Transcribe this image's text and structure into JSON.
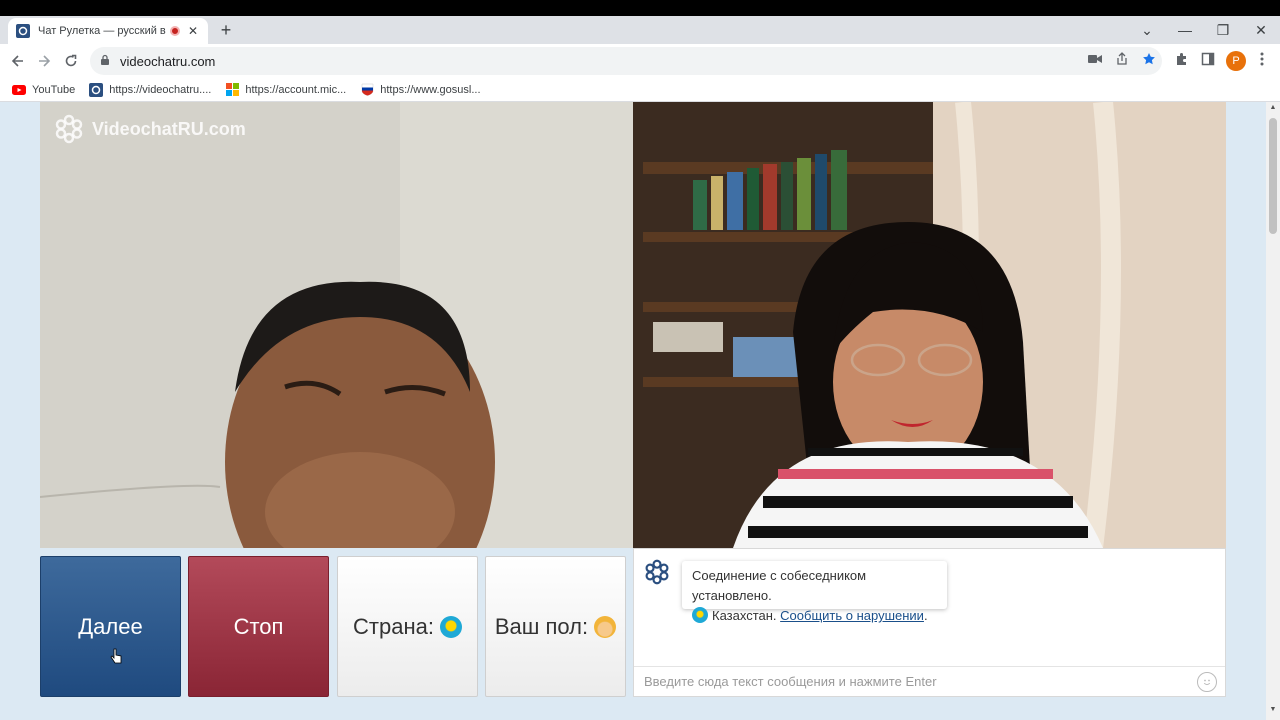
{
  "browser": {
    "tab_title": "Чат Рулетка — русский вид",
    "tab_close": "✕",
    "new_tab": "+",
    "url": "videochatru.com",
    "profile_initial": "P",
    "controls": {
      "dropdown": "⌄",
      "minimize": "—",
      "restore": "❐",
      "close": "✕"
    }
  },
  "bookmarks": [
    {
      "label": "YouTube",
      "icon": "youtube-icon"
    },
    {
      "label": "https://videochatru....",
      "icon": "videochat-icon"
    },
    {
      "label": "https://account.mic...",
      "icon": "microsoft-icon"
    },
    {
      "label": "https://www.gosusl...",
      "icon": "gosuslugi-icon"
    }
  ],
  "site": {
    "logo_text": "VideochatRU.com",
    "buttons": {
      "next": "Далее",
      "stop": "Стоп",
      "country": "Страна:",
      "gender": "Ваш пол:"
    },
    "chat": {
      "system_message": "Соединение с собеседником установлено.",
      "country": "Казахстан.",
      "report_link": "Сообщить о нарушении",
      "trailing": ".",
      "input_placeholder": "Введите сюда текст сообщения и нажмите Enter"
    }
  },
  "colors": {
    "next_button": "#1f4a7f",
    "stop_button": "#8a2535",
    "page_background": "#dce9f3"
  }
}
